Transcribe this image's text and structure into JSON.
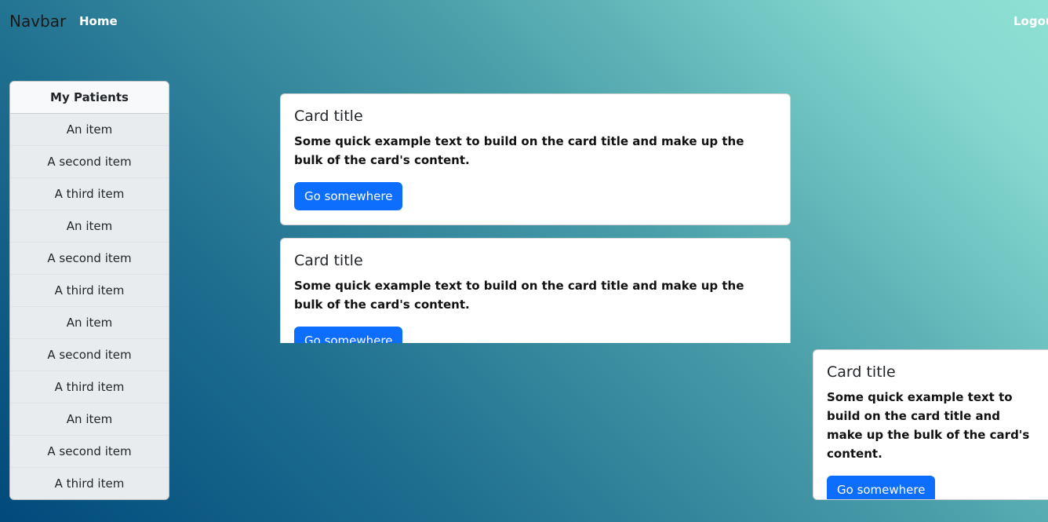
{
  "navbar": {
    "brand": "Navbar",
    "home_label": "Home",
    "logout_label": "Logout"
  },
  "sidebar": {
    "title": "My Patients",
    "items": [
      {
        "label": "An item"
      },
      {
        "label": "A second item"
      },
      {
        "label": "A third item"
      },
      {
        "label": "An item"
      },
      {
        "label": "A second item"
      },
      {
        "label": "A third item"
      },
      {
        "label": "An item"
      },
      {
        "label": "A second item"
      },
      {
        "label": "A third item"
      },
      {
        "label": "An item"
      },
      {
        "label": "A second item"
      },
      {
        "label": "A third item"
      }
    ]
  },
  "cards": [
    {
      "title": "Card title",
      "text": "Some quick example text to build on the card title and make up the bulk of the card's content.",
      "button_label": "Go somewhere"
    },
    {
      "title": "Card title",
      "text": "Some quick example text to build on the card title and make up the bulk of the card's content.",
      "button_label": "Go somewhere"
    },
    {
      "title": "Card title",
      "text": "Some quick example text to build on the card title and make up the bulk of the card's content.",
      "button_label": "Go somewhere"
    }
  ],
  "colors": {
    "primary": "#0d6efd",
    "gradient_dark": "#004a7c",
    "gradient_light": "#8fe0d4"
  }
}
